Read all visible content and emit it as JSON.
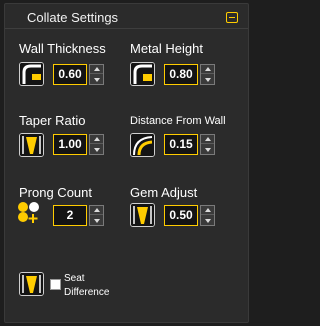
{
  "panel": {
    "title": "Collate Settings"
  },
  "wall_thickness": {
    "label": "Wall Thickness",
    "value": "0.60",
    "icon": "wall-thickness-icon"
  },
  "metal_height": {
    "label": "Metal Height",
    "value": "0.80",
    "icon": "metal-height-icon"
  },
  "taper_ratio": {
    "label": "Taper Ratio",
    "value": "1.00",
    "icon": "taper-ratio-icon"
  },
  "distance_from_wall": {
    "label": "Distance From Wall",
    "value": "0.15",
    "icon": "distance-from-wall-icon"
  },
  "prong_count": {
    "label": "Prong Count",
    "value": "2",
    "icon": "prong-count-icon"
  },
  "gem_adjust": {
    "label": "Gem Adjust",
    "value": "0.50",
    "icon": "gem-adjust-icon"
  },
  "seat_difference": {
    "label_line1": "Seat",
    "label_line2": "Difference",
    "checked": false,
    "icon": "seat-difference-icon"
  },
  "colors": {
    "accent": "#ffcc00",
    "panel": "#2b2b2b",
    "field": "#141414"
  }
}
